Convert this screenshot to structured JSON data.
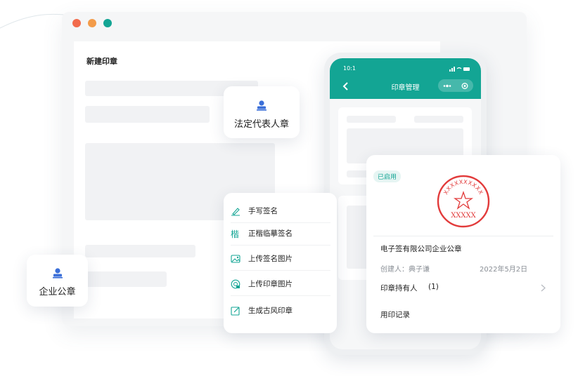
{
  "editor": {
    "title": "新建印章"
  },
  "legal_seal_card": {
    "label": "法定代表人章"
  },
  "company_seal_card": {
    "label": "企业公章"
  },
  "phone": {
    "time": "10:1",
    "title": "印章管理"
  },
  "menu": {
    "items": [
      {
        "label": "手写签名",
        "icon": "pen-icon"
      },
      {
        "label": "正楷临摹签名",
        "icon": "calligraphy-icon"
      },
      {
        "label": "上传签名图片",
        "icon": "image-upload-icon"
      },
      {
        "label": "上传印章图片",
        "icon": "seal-upload-icon"
      },
      {
        "label": "生成古风印章",
        "icon": "edit-box-icon"
      }
    ]
  },
  "seal_card": {
    "status": "已启用",
    "seal_bottom_text": "XXXXX",
    "seal_arc_text": "XXXXXXXXXX",
    "company_name": "电子签有限公司企业公章",
    "creator": "创建人：典子谦",
    "date": "2022年5月2日",
    "holders_label": "印章持有人",
    "holders_count": "(1)",
    "usage_record": "用印记录"
  },
  "colors": {
    "accent": "#13a594",
    "seal_red": "#e23b3b",
    "dot_red": "#f26b4c",
    "dot_orange": "#f39c4a",
    "dot_teal": "#13a594"
  }
}
